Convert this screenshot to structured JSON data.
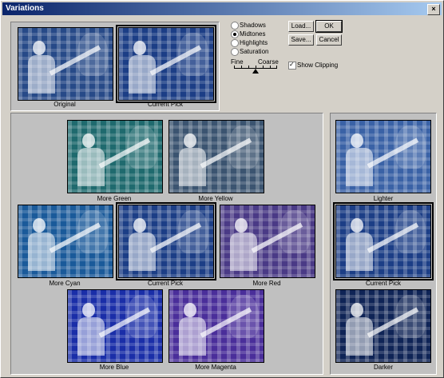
{
  "window": {
    "title": "Variations",
    "close_glyph": "×"
  },
  "tone_options": [
    {
      "label": "Shadows",
      "selected": false
    },
    {
      "label": "Midtones",
      "selected": true
    },
    {
      "label": "Highlights",
      "selected": false
    },
    {
      "label": "Saturation",
      "selected": false
    }
  ],
  "buttons": {
    "load": "Load...",
    "save": "Save...",
    "ok": "OK",
    "cancel": "Cancel"
  },
  "slider": {
    "fine_label": "Fine",
    "coarse_label": "Coarse",
    "position": 0.5
  },
  "show_clipping": {
    "label": "Show Clipping",
    "checked": true
  },
  "compare": {
    "original": "Original",
    "current": "Current Pick"
  },
  "color_variations": {
    "more_green": "More Green",
    "more_yellow": "More Yellow",
    "more_cyan": "More Cyan",
    "current": "Current Pick",
    "more_red": "More Red",
    "more_blue": "More Blue",
    "more_magenta": "More Magenta"
  },
  "brightness_variations": {
    "lighter": "Lighter",
    "current": "Current Pick",
    "darker": "Darker"
  },
  "colors": {
    "original": "#274a88",
    "current": "#1c3e86",
    "more_green": "#1f6a6e",
    "more_yellow": "#3b5470",
    "more_cyan": "#1a5a9a",
    "more_red": "#4a3a86",
    "more_blue": "#1a2ea8",
    "more_magenta": "#4a2e9a",
    "lighter": "#3a62a6",
    "darker": "#0f2456"
  }
}
